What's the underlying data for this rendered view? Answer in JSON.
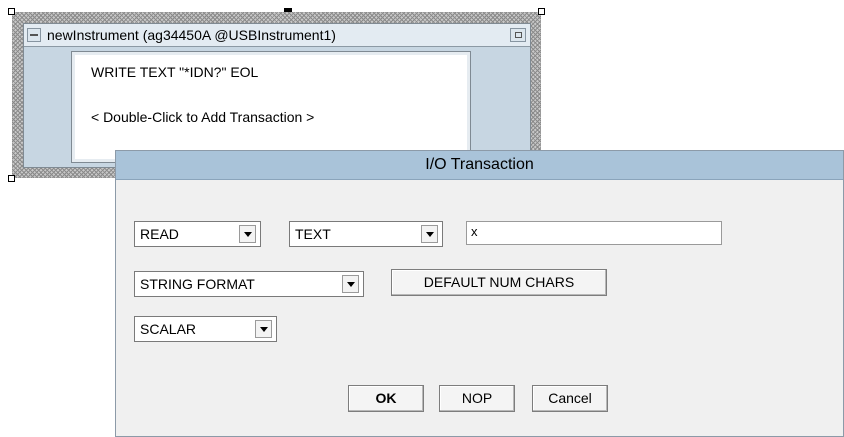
{
  "instrument": {
    "title": "newInstrument (ag34450A @USBInstrument1)",
    "transactions": [
      "WRITE TEXT \"*IDN?\" EOL",
      "< Double-Click to Add Transaction >"
    ]
  },
  "dialog": {
    "title": "I/O Transaction",
    "action_select": "READ",
    "format_select": "TEXT",
    "variable_value": "x",
    "type_select": "STRING FORMAT",
    "default_num_chars_label": "DEFAULT NUM CHARS",
    "shape_select": "SCALAR",
    "ok_label": "OK",
    "nop_label": "NOP",
    "cancel_label": "Cancel"
  },
  "colors": {
    "dialog_title_bg": "#a9c3d9",
    "instrument_body_bg": "#c7d6e2",
    "dialog_bg": "#f0f0f0"
  }
}
